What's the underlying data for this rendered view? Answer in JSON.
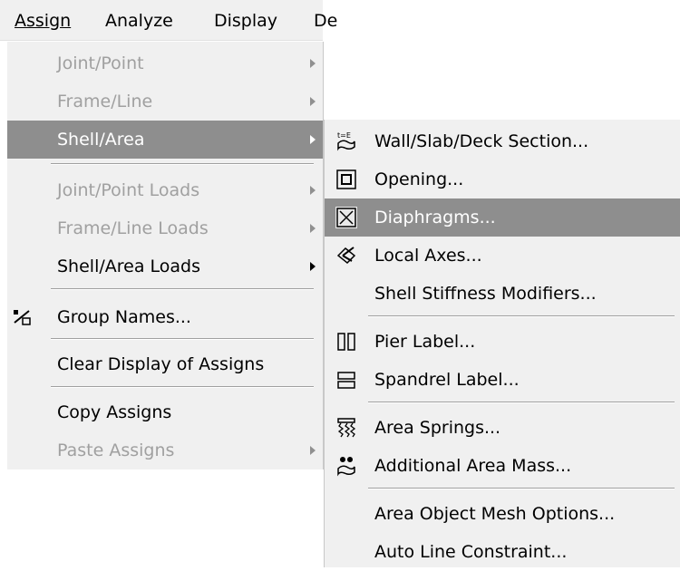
{
  "menubar": {
    "items": [
      {
        "label": "Assign"
      },
      {
        "label": "Analyze"
      },
      {
        "label": "Display"
      },
      {
        "label": "De"
      }
    ]
  },
  "assign_menu": {
    "items": [
      {
        "label": "Joint/Point",
        "disabled": true,
        "submenu": true
      },
      {
        "label": "Frame/Line",
        "disabled": true,
        "submenu": true
      },
      {
        "label": "Shell/Area",
        "selected": true,
        "submenu": true
      },
      {
        "label": "Joint/Point Loads",
        "disabled": true,
        "submenu": true
      },
      {
        "label": "Frame/Line Loads",
        "disabled": true,
        "submenu": true
      },
      {
        "label": "Shell/Area Loads",
        "submenu": true
      },
      {
        "label": "Group Names...",
        "icon": "group-names-icon"
      },
      {
        "label": "Clear Display of Assigns"
      },
      {
        "label": "Copy Assigns"
      },
      {
        "label": "Paste Assigns",
        "disabled": true,
        "submenu": true
      }
    ]
  },
  "shell_area_submenu": {
    "items": [
      {
        "label": "Wall/Slab/Deck Section...",
        "icon": "wall-slab-deck-icon"
      },
      {
        "label": "Opening...",
        "icon": "opening-icon"
      },
      {
        "label": "Diaphragms...",
        "icon": "diaphragm-icon",
        "selected": true
      },
      {
        "label": "Local Axes...",
        "icon": "local-axes-icon"
      },
      {
        "label": "Shell Stiffness Modifiers..."
      },
      {
        "label": "Pier Label...",
        "icon": "pier-label-icon"
      },
      {
        "label": "Spandrel Label...",
        "icon": "spandrel-label-icon"
      },
      {
        "label": "Area Springs...",
        "icon": "area-springs-icon"
      },
      {
        "label": "Additional Area Mass...",
        "icon": "area-mass-icon"
      },
      {
        "label": "Area Object Mesh Options..."
      },
      {
        "label": "Auto Line Constraint..."
      }
    ]
  },
  "colors": {
    "menu_bg": "#f0f0f0",
    "highlight": "#8e8e8e",
    "disabled_text": "#a0a0a0"
  }
}
